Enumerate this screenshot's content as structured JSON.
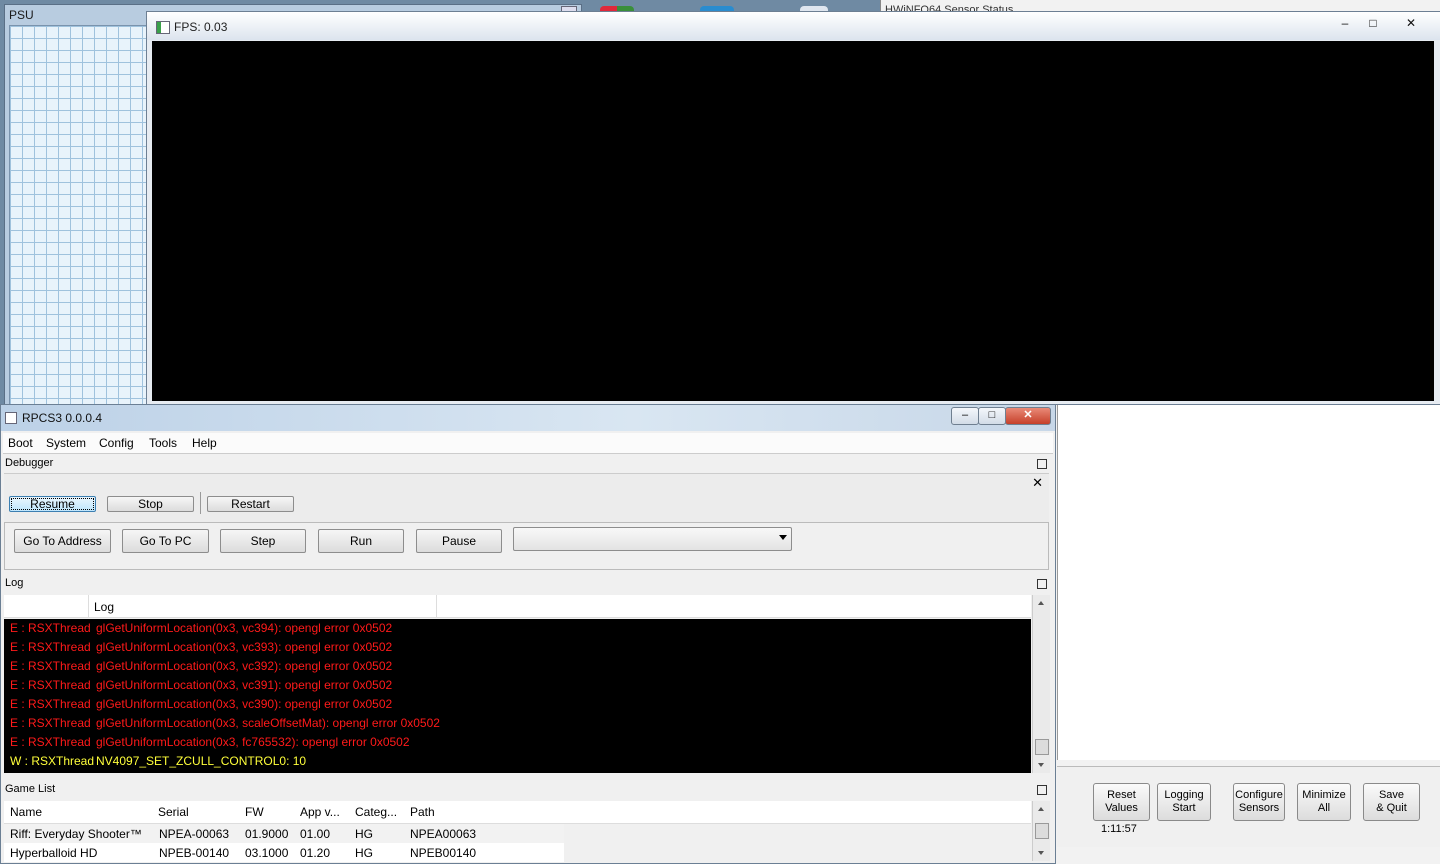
{
  "background": {
    "psu_title": "PSU",
    "hwinfo_title": "HWiNFO64 Sensor Status"
  },
  "fps_window": {
    "title": "FPS: 0.03",
    "controls": {
      "minimize": "–",
      "maximize": "□",
      "close": "✕"
    }
  },
  "rpcs3": {
    "title": "RPCS3 0.0.0.4",
    "controls": {
      "minimize": "–",
      "maximize": "□",
      "close": "✕"
    },
    "menu": [
      "Boot",
      "System",
      "Config",
      "Tools",
      "Help"
    ],
    "debugger": {
      "label": "Debugger",
      "row1": [
        "Resume",
        "Stop",
        "Restart"
      ],
      "row2": [
        "Go To Address",
        "Go To PC",
        "Step",
        "Run",
        "Pause"
      ],
      "combo_value": ""
    },
    "log": {
      "label": "Log",
      "column": "Log",
      "lines": [
        {
          "src": "E : RSXThread",
          "msg": "glGetUniformLocation(0x3, vc394): opengl error 0x0502",
          "level": "error"
        },
        {
          "src": "E : RSXThread",
          "msg": "glGetUniformLocation(0x3, vc393): opengl error 0x0502",
          "level": "error"
        },
        {
          "src": "E : RSXThread",
          "msg": "glGetUniformLocation(0x3, vc392): opengl error 0x0502",
          "level": "error"
        },
        {
          "src": "E : RSXThread",
          "msg": "glGetUniformLocation(0x3, vc391): opengl error 0x0502",
          "level": "error"
        },
        {
          "src": "E : RSXThread",
          "msg": "glGetUniformLocation(0x3, vc390): opengl error 0x0502",
          "level": "error"
        },
        {
          "src": "E : RSXThread",
          "msg": "glGetUniformLocation(0x3, scaleOffsetMat): opengl error 0x0502",
          "level": "error"
        },
        {
          "src": "E : RSXThread",
          "msg": "glGetUniformLocation(0x3, fc765532): opengl error 0x0502",
          "level": "error"
        },
        {
          "src": "W : RSXThread",
          "msg": "NV4097_SET_ZCULL_CONTROL0: 10",
          "level": "warning"
        }
      ],
      "colors": {
        "error": "#ff1a1a",
        "warning": "#ffff3a"
      }
    },
    "game_list": {
      "label": "Game List",
      "columns": [
        "Name",
        "Serial",
        "FW",
        "App v...",
        "Categ...",
        "Path"
      ],
      "rows": [
        [
          "Riff: Everyday Shooter™",
          "NPEA-00063",
          "01.9000",
          "01.00",
          "HG",
          "NPEA00063"
        ],
        [
          "Hyperballoid HD",
          "NPEB-00140",
          "03.1000",
          "01.20",
          "HG",
          "NPEB00140"
        ]
      ]
    }
  },
  "hwinfo": {
    "buttons": [
      "Reset\nValues",
      "Logging\nStart",
      "Configure\nSensors",
      "Minimize\nAll",
      "Save\n& Quit"
    ],
    "timer": "1:11:57"
  }
}
